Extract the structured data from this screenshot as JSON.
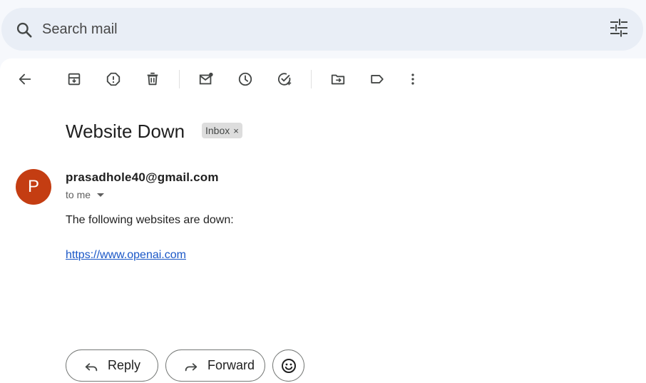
{
  "search": {
    "placeholder": "Search mail"
  },
  "toolbar": {
    "items": [
      "back-arrow-icon",
      "archive-icon",
      "report-spam-icon",
      "delete-icon",
      "mark-unread-icon",
      "snooze-icon",
      "add-task-icon",
      "move-to-icon",
      "label-icon",
      "more-vert-icon"
    ]
  },
  "email": {
    "subject": "Website Down",
    "label": "Inbox",
    "label_close": "×",
    "avatar_letter": "P",
    "sender": "prasadhole40@gmail.com",
    "recipient": "to me",
    "body_line": "The following websites are down:",
    "link": "https://www.openai.com"
  },
  "actions": {
    "reply_label": "Reply",
    "forward_label": "Forward"
  },
  "colors": {
    "avatar": "#c43d12",
    "link": "#1a57c7",
    "search_bg": "#e9eef6"
  }
}
